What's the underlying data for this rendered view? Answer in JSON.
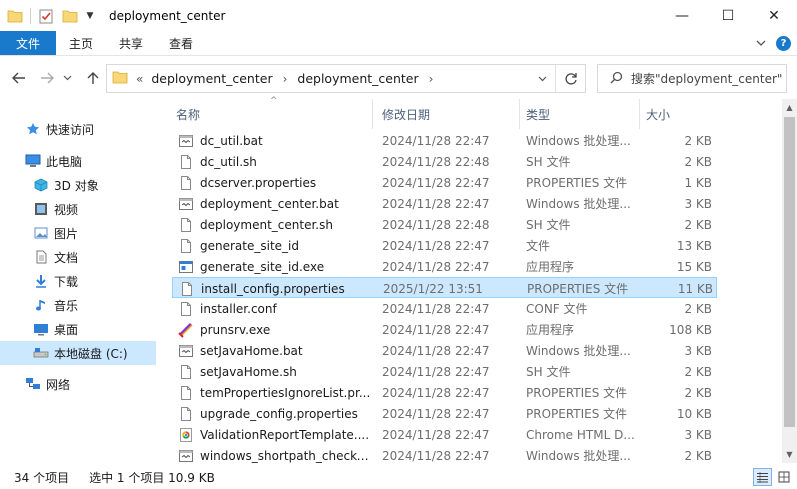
{
  "window": {
    "title": "deployment_center",
    "controls": {
      "minimize": "—",
      "maximize": "☐",
      "close": "✕"
    }
  },
  "ribbon": {
    "tabs": [
      {
        "label": "文件"
      },
      {
        "label": "主页"
      },
      {
        "label": "共享"
      },
      {
        "label": "查看"
      }
    ],
    "expand_icon": "chevron-down",
    "help_label": "?"
  },
  "address": {
    "overflow": "«",
    "crumbs": [
      "deployment_center",
      "deployment_center"
    ],
    "search_placeholder": "搜索\"deployment_center\""
  },
  "nav": {
    "quick_access": "快速访问",
    "this_pc": "此电脑",
    "objects_3d": "3D 对象",
    "videos": "视频",
    "pictures": "图片",
    "documents": "文档",
    "downloads": "下载",
    "music": "音乐",
    "desktop": "桌面",
    "local_disk": "本地磁盘 (C:)",
    "network": "网络"
  },
  "columns": {
    "name": "名称",
    "date": "修改日期",
    "type": "类型",
    "size": "大小"
  },
  "files": [
    {
      "name": "dc_util.bat",
      "date": "2024/11/28 22:47",
      "type": "Windows 批处理...",
      "size": "2 KB",
      "icon": "bat"
    },
    {
      "name": "dc_util.sh",
      "date": "2024/11/28 22:48",
      "type": "SH 文件",
      "size": "2 KB",
      "icon": "file"
    },
    {
      "name": "dcserver.properties",
      "date": "2024/11/28 22:47",
      "type": "PROPERTIES 文件",
      "size": "1 KB",
      "icon": "file"
    },
    {
      "name": "deployment_center.bat",
      "date": "2024/11/28 22:47",
      "type": "Windows 批处理...",
      "size": "3 KB",
      "icon": "bat"
    },
    {
      "name": "deployment_center.sh",
      "date": "2024/11/28 22:48",
      "type": "SH 文件",
      "size": "2 KB",
      "icon": "file"
    },
    {
      "name": "generate_site_id",
      "date": "2024/11/28 22:47",
      "type": "文件",
      "size": "13 KB",
      "icon": "file"
    },
    {
      "name": "generate_site_id.exe",
      "date": "2024/11/28 22:47",
      "type": "应用程序",
      "size": "15 KB",
      "icon": "exe"
    },
    {
      "name": "install_config.properties",
      "date": "2025/1/22 13:51",
      "type": "PROPERTIES 文件",
      "size": "11 KB",
      "icon": "file",
      "selected": true
    },
    {
      "name": "installer.conf",
      "date": "2024/11/28 22:47",
      "type": "CONF 文件",
      "size": "2 KB",
      "icon": "file"
    },
    {
      "name": "prunsrv.exe",
      "date": "2024/11/28 22:47",
      "type": "应用程序",
      "size": "108 KB",
      "icon": "prunsrv"
    },
    {
      "name": "setJavaHome.bat",
      "date": "2024/11/28 22:47",
      "type": "Windows 批处理...",
      "size": "3 KB",
      "icon": "bat"
    },
    {
      "name": "setJavaHome.sh",
      "date": "2024/11/28 22:47",
      "type": "SH 文件",
      "size": "2 KB",
      "icon": "file"
    },
    {
      "name": "temPropertiesIgnoreList.pr...",
      "date": "2024/11/28 22:47",
      "type": "PROPERTIES 文件",
      "size": "2 KB",
      "icon": "file"
    },
    {
      "name": "upgrade_config.properties",
      "date": "2024/11/28 22:47",
      "type": "PROPERTIES 文件",
      "size": "10 KB",
      "icon": "file"
    },
    {
      "name": "ValidationReportTemplate....",
      "date": "2024/11/28 22:47",
      "type": "Chrome HTML D...",
      "size": "3 KB",
      "icon": "chrome"
    },
    {
      "name": "windows_shortpath_checker...",
      "date": "2024/11/28 22:47",
      "type": "Windows 批处理...",
      "size": "2 KB",
      "icon": "bat"
    }
  ],
  "status": {
    "count": "34 个项目",
    "selection": "选中 1 个项目  10.9 KB"
  },
  "colors": {
    "accent": "#1979ca",
    "selection_bg": "#cce8ff",
    "selection_border": "#99d1ff",
    "folder_yellow": "#f8d775"
  }
}
